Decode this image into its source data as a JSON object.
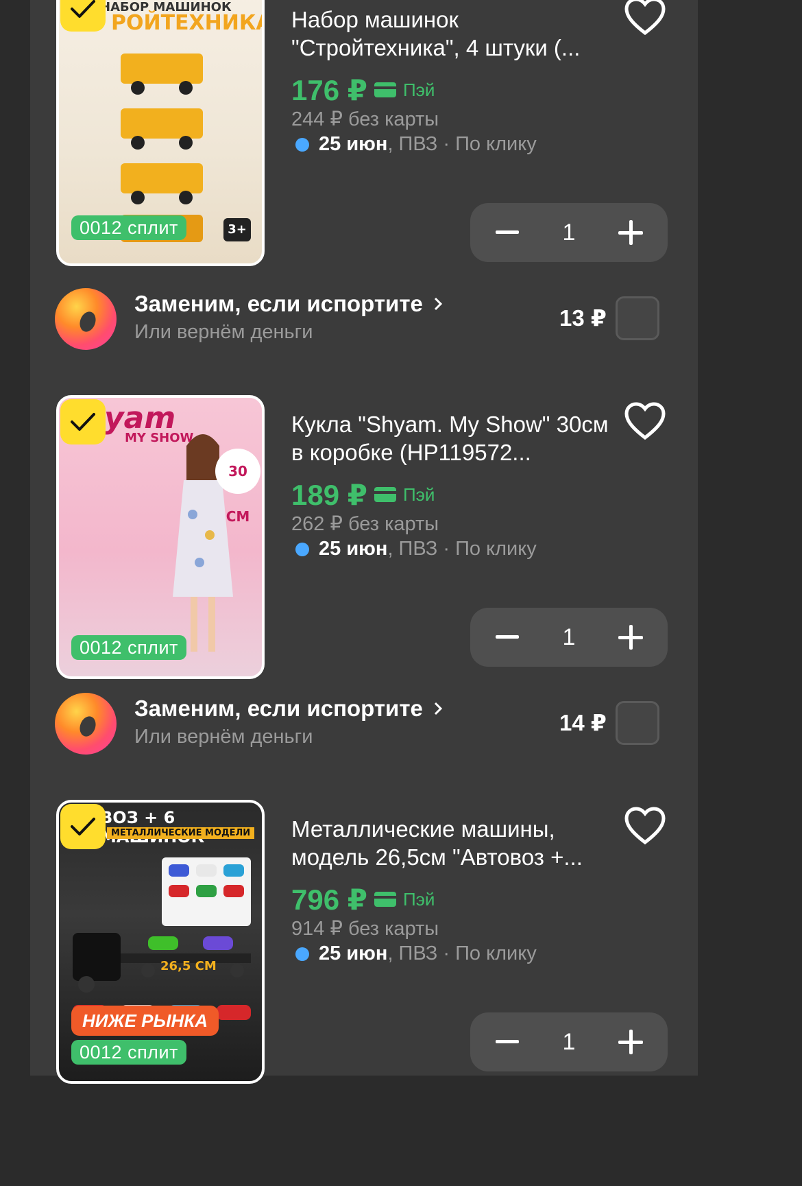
{
  "products": [
    {
      "title": "Набор машинок \"Стройтехника\", 4 штуки (...",
      "price": "176 ₽",
      "pay_label": "Пэй",
      "old_price": "244 ₽ без карты",
      "delivery_date": "25 июн",
      "delivery_rest": ", ПВЗ · По клику",
      "split_label": "0012 сплит",
      "quantity": "1",
      "image_text_top": "НАБОР МАШИНОК",
      "image_text_main": "РОЙТЕХНИКА",
      "image_badge": "3+"
    },
    {
      "title": "Кукла \"Shyam. My Show\" 30см в коробке (HP119572...",
      "price": "189 ₽",
      "pay_label": "Пэй",
      "old_price": "262 ₽ без карты",
      "delivery_date": "25 июн",
      "delivery_rest": ", ПВЗ · По клику",
      "split_label": "0012 сплит",
      "quantity": "1",
      "image_text_top": "yam",
      "image_text_main": "MY SHOW",
      "image_badge": "30 СМ"
    },
    {
      "title": "Металлические машины, модель 26,5см \"Автовоз +...",
      "price": "796 ₽",
      "pay_label": "Пэй",
      "old_price": "914 ₽ без карты",
      "delivery_date": "25 июн",
      "delivery_rest": ", ПВЗ · По клику",
      "split_label": "0012 сплит",
      "below_market": "НИЖЕ РЫНКА",
      "quantity": "1",
      "image_text_top": "ВОЗ + 6 МАШИНОК",
      "image_text_main": "МЕТАЛЛИЧЕСКИЕ МОДЕЛИ",
      "image_badge": "26,5 СМ"
    }
  ],
  "insurance": [
    {
      "title": "Заменим, если испортите",
      "subtitle": "Или вернём деньги",
      "price": "13 ₽"
    },
    {
      "title": "Заменим, если испортите",
      "subtitle": "Или вернём деньги",
      "price": "14 ₽"
    }
  ],
  "colors": {
    "background": "#2b2b2b",
    "card": "#3b3b3b",
    "price_green": "#3fbf6b",
    "check_yellow": "#ffdd2d",
    "delivery_dot": "#4aa8ff",
    "muted_text": "#9b9b9b"
  },
  "icons": [
    "check-icon",
    "heart-icon",
    "card-icon",
    "minus-icon",
    "plus-icon",
    "chevron-right-icon",
    "insurance-logo-icon"
  ]
}
